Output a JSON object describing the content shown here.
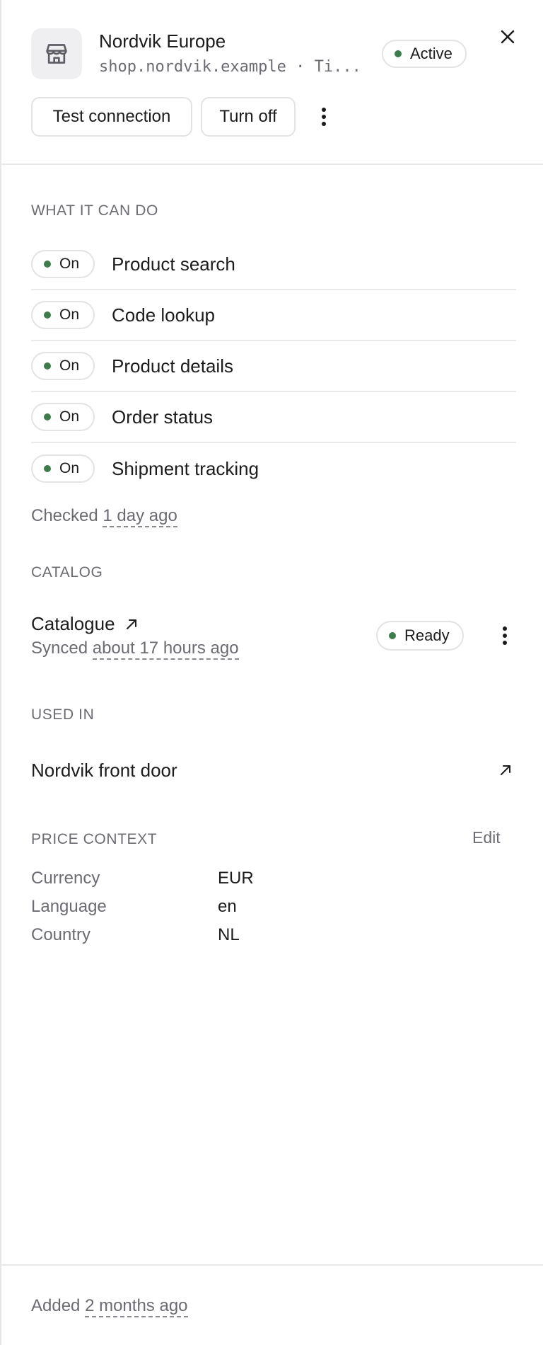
{
  "header": {
    "title": "Nordvik Europe",
    "subtitle": "shop.nordvik.example · Ti...",
    "status": "Active",
    "status_color": "#3e7b4c",
    "store_icon": "storefront-icon",
    "close_icon": "close-icon",
    "actions": {
      "test_connection": "Test connection",
      "turn_off": "Turn off",
      "more_icon": "more-vertical-icon"
    }
  },
  "capabilities": {
    "heading": "What it can do",
    "items": [
      {
        "state": "On",
        "label": "Product search"
      },
      {
        "state": "On",
        "label": "Code lookup"
      },
      {
        "state": "On",
        "label": "Product details"
      },
      {
        "state": "On",
        "label": "Order status"
      },
      {
        "state": "On",
        "label": "Shipment tracking"
      }
    ],
    "checked_prefix": "Checked",
    "checked_time": "1 day ago"
  },
  "catalog": {
    "heading": "Catalog",
    "name": "Catalogue",
    "synced_prefix": "Synced",
    "synced_time": "about 17 hours ago",
    "status": "Ready",
    "link_icon": "external-link-icon"
  },
  "used_in": {
    "heading": "Used in",
    "item": "Nordvik front door",
    "link_icon": "external-link-icon"
  },
  "price_context": {
    "heading": "Price context",
    "edit": "Edit",
    "rows": [
      {
        "key": "Currency",
        "value": "EUR"
      },
      {
        "key": "Language",
        "value": "en"
      },
      {
        "key": "Country",
        "value": "NL"
      }
    ]
  },
  "footer": {
    "added_prefix": "Added",
    "added_time": "2 months ago"
  }
}
